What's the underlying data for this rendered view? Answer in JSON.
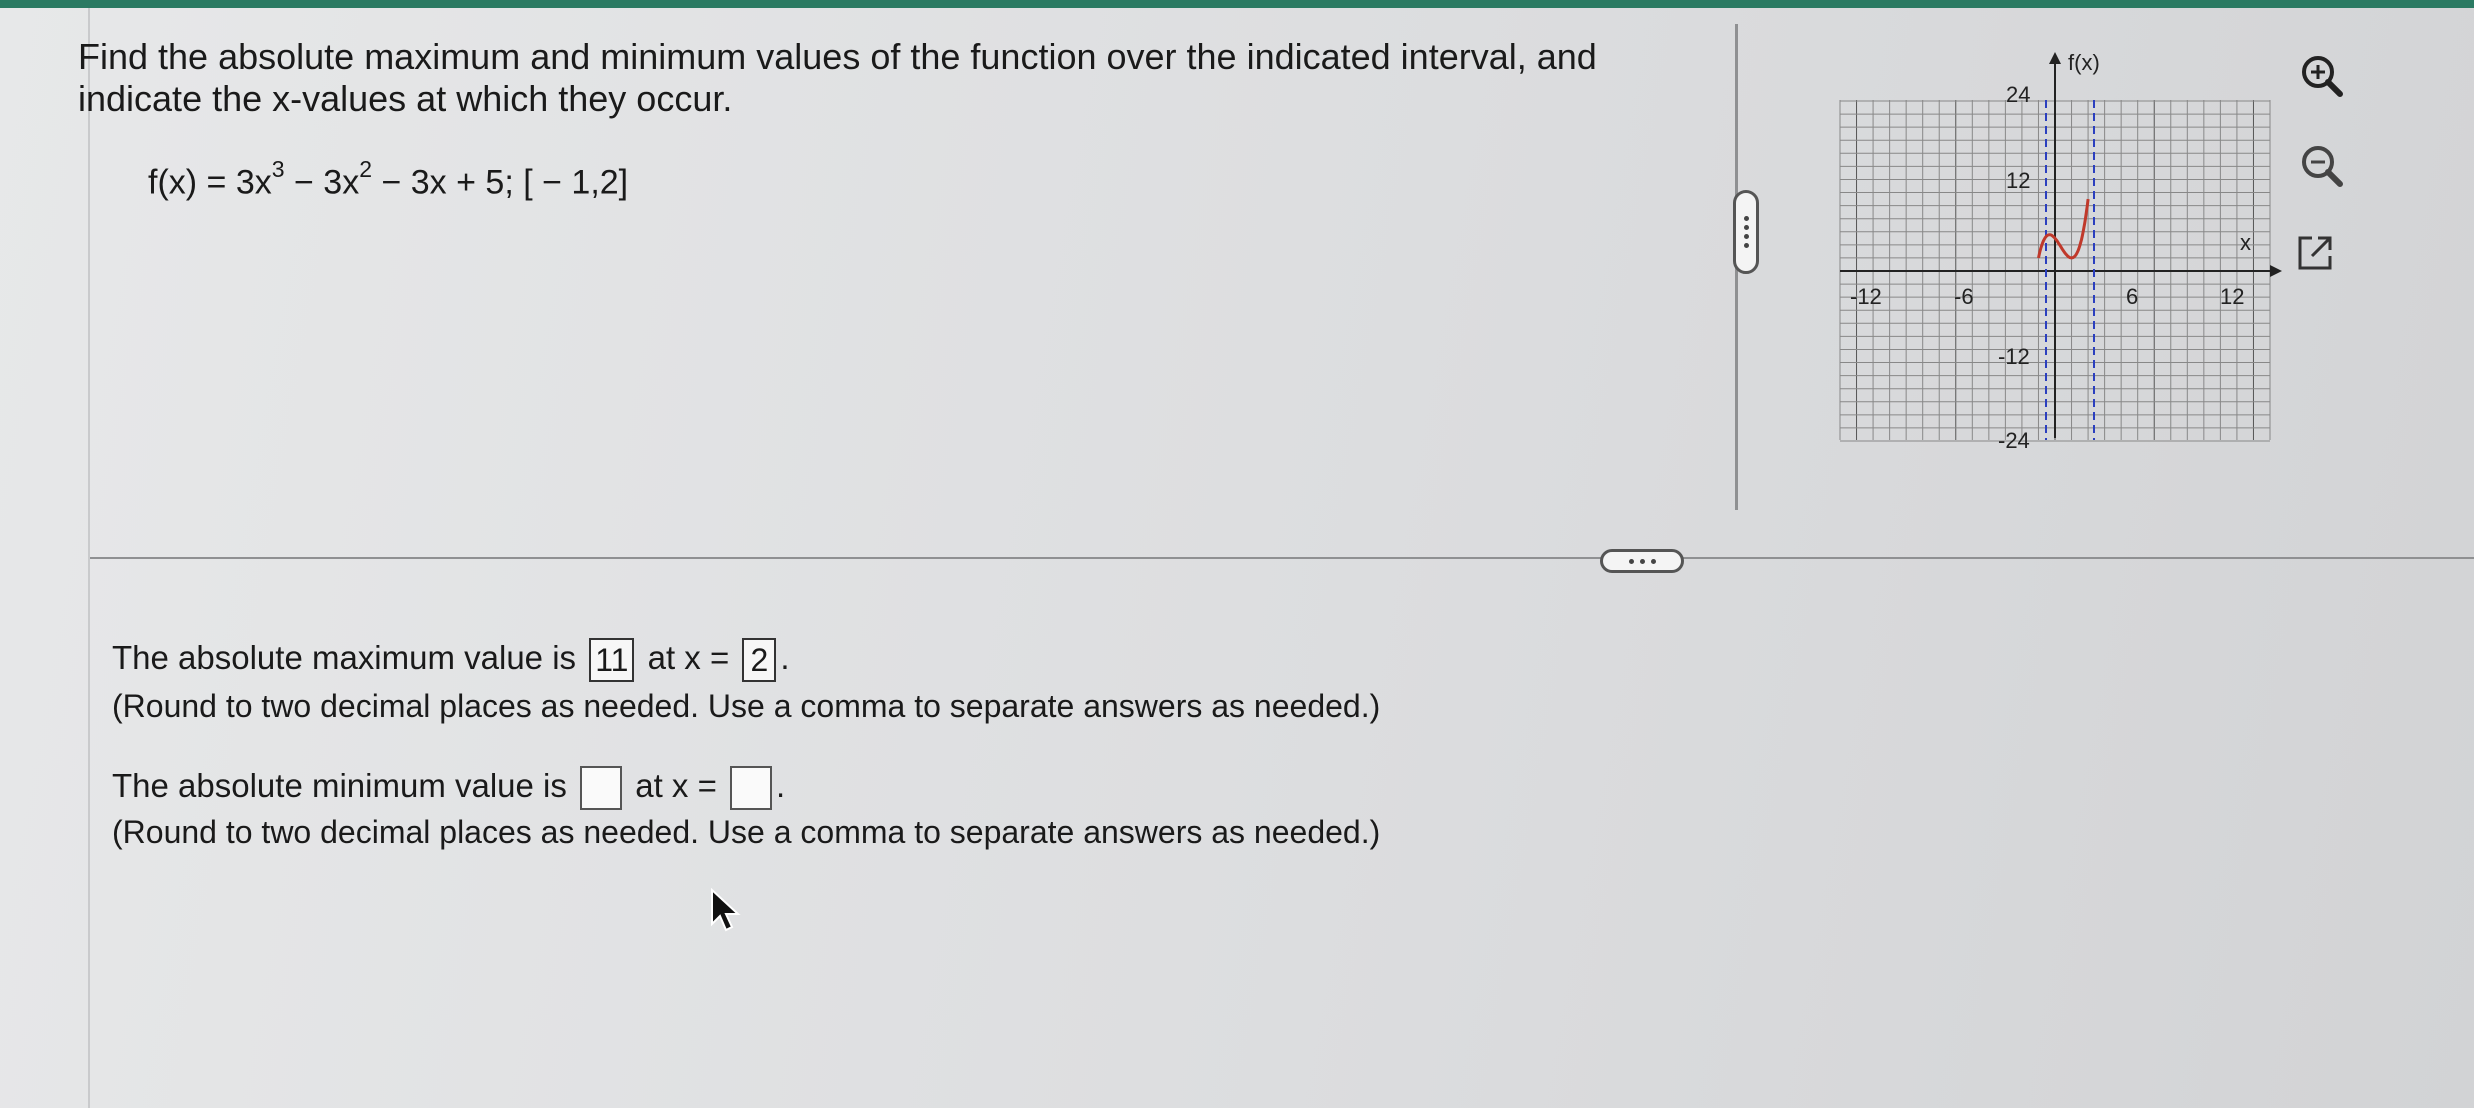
{
  "question": {
    "prompt": "Find the absolute maximum and minimum values of the function over the indicated interval, and indicate the x-values at which they occur.",
    "formula_prefix": "f(x) = 3x",
    "exp1": "3",
    "formula_mid": " − 3x",
    "exp2": "2",
    "formula_suffix": " − 3x + 5; [ − 1,2]"
  },
  "graph": {
    "y_label": "f(x)",
    "x_label": "x",
    "x_ticks": [
      "-12",
      "-6",
      "6",
      "12"
    ],
    "y_ticks": [
      "24",
      "12",
      "-12",
      "-24"
    ],
    "curve_color": "#c0392b",
    "dash_color": "#2b3fbf"
  },
  "tools": {
    "zoom_in_icon": "zoom-in-icon",
    "zoom_out_icon": "zoom-out-icon",
    "popout_icon": "external-link-icon"
  },
  "answers": {
    "max_prefix": "The absolute maximum value is",
    "max_value": "11",
    "at_label": "at x =",
    "max_x": "2",
    "period": ".",
    "min_prefix": "The absolute minimum value is",
    "min_value": "",
    "min_x": "",
    "round_note": "(Round to two decimal places as needed. Use a comma to separate answers as needed.)"
  }
}
